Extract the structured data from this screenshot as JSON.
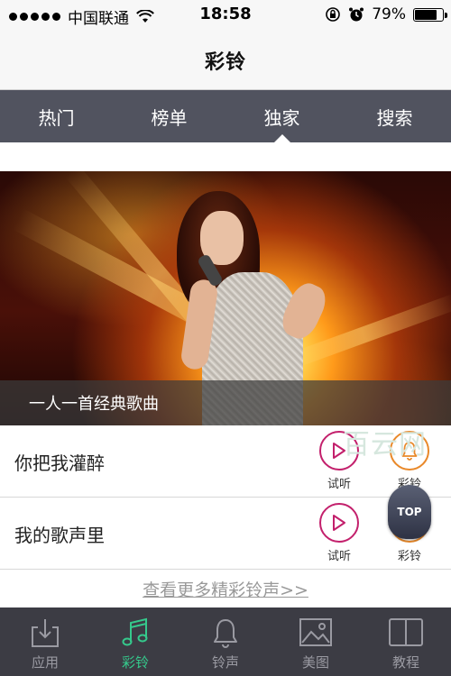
{
  "status_bar": {
    "carrier": "中国联通",
    "time": "18:58",
    "battery": "79%",
    "battery_level": 0.79
  },
  "nav": {
    "title": "彩铃"
  },
  "tabs": [
    {
      "label": "热门"
    },
    {
      "label": "榜单"
    },
    {
      "label": "独家",
      "active": true
    },
    {
      "label": "搜索"
    }
  ],
  "banner": {
    "caption": "一人一首经典歌曲"
  },
  "songs": [
    {
      "title": "你把我灌醉",
      "preview_label": "试听",
      "ringtone_label": "彩铃"
    },
    {
      "title": "我的歌声里",
      "preview_label": "试听",
      "ringtone_label": "彩铃"
    }
  ],
  "more_link": "查看更多精彩铃声>>",
  "watermark": "百云网",
  "top_button": "TOP",
  "bottom_tabs": [
    {
      "label": "应用",
      "icon": "download-icon"
    },
    {
      "label": "彩铃",
      "icon": "music-note-icon",
      "active": true
    },
    {
      "label": "铃声",
      "icon": "bell-icon"
    },
    {
      "label": "美图",
      "icon": "image-icon"
    },
    {
      "label": "教程",
      "icon": "book-icon"
    }
  ],
  "colors": {
    "tab_bar": "#51535f",
    "play_accent": "#c3206c",
    "bell_accent": "#e9892a",
    "bottom_active": "#35c98c"
  }
}
